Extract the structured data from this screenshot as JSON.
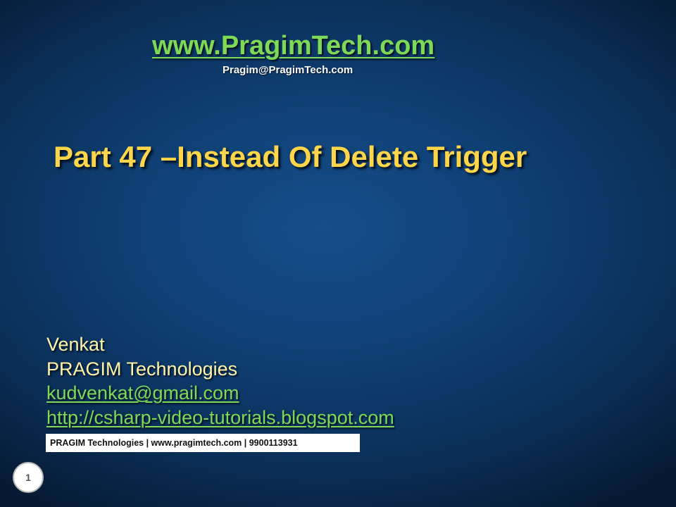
{
  "header": {
    "website": "www.PragimTech.com",
    "email": "Pragim@PragimTech.com"
  },
  "slide": {
    "title": "Part 47 –Instead Of Delete Trigger"
  },
  "author": {
    "name": "Venkat",
    "company": "PRAGIM Technologies",
    "email": "kudvenkat@gmail.com",
    "blog": "http://csharp-video-tutorials.blogspot.com"
  },
  "footer": {
    "text": "PRAGIM Technologies | www.pragimtech.com | 9900113931"
  },
  "page_number": "1",
  "colors": {
    "title": "#ffd54a",
    "link": "#7ed957",
    "author_text": "#fff3a8",
    "background": "#0f3f73"
  }
}
